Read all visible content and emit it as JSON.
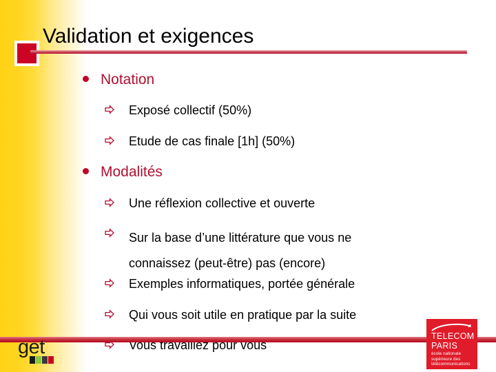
{
  "slide": {
    "title": "Validation et exigences",
    "sections": [
      {
        "heading": "Notation",
        "items": [
          "Exposé collectif (50%)",
          "Etude de cas finale [1h] (50%)"
        ]
      },
      {
        "heading": "Modalités",
        "items": [
          "Une réflexion collective et ouverte",
          "Sur la base d’une littérature que vous ne\nconnaissez (peut-être) pas (encore)",
          "Exemples informatiques, portée générale",
          "Qui vous soit utile en pratique par la suite",
          "Vous travaillez pour vous"
        ]
      }
    ]
  },
  "logos": {
    "telecom": {
      "name_line1": "TELECOM",
      "name_line2": "PARIS",
      "subtitle": "école nationale supérieure des télécommunications"
    },
    "get": {
      "wordmark": "get"
    }
  },
  "colors": {
    "accent_red": "#b01030",
    "square_red": "#cc0424",
    "logo_red": "#e01b2a",
    "gradient_yellow": "#ffd215",
    "text_black": "#000000"
  },
  "icons": {
    "bullet_dot": "filled-circle",
    "bullet_arrow": "hollow-right-arrow"
  }
}
